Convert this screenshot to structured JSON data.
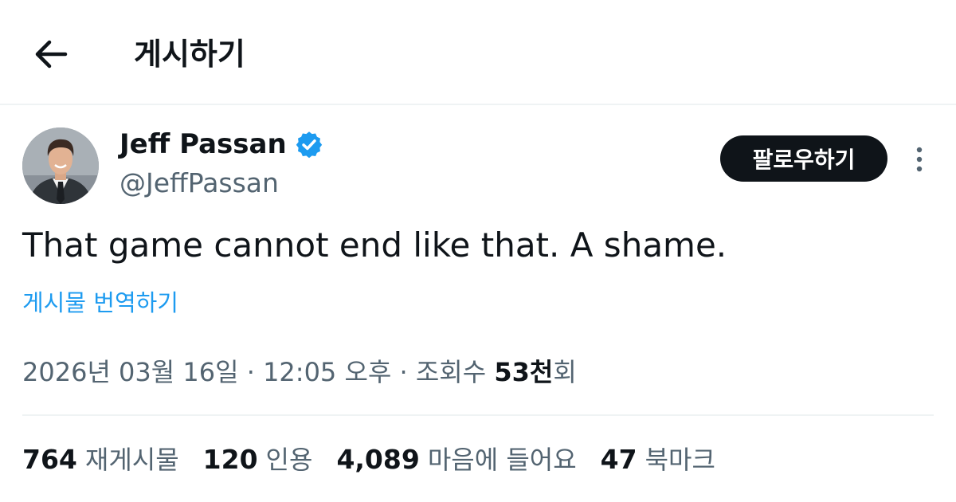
{
  "header": {
    "title": "게시하기",
    "back_icon": "arrow-left-icon"
  },
  "author": {
    "name": "Jeff Passan",
    "handle": "@JeffPassan",
    "verified": true,
    "verified_color": "#1d9bf0"
  },
  "follow_button": {
    "label": "팔로우하기"
  },
  "tweet": {
    "text": "That game cannot end like that. A shame.",
    "translate_label": "게시물 번역하기",
    "date": "2026년 03월 16일",
    "time": "12:05 오후",
    "views_label": "조회수",
    "views_count": "53천",
    "views_suffix": "회"
  },
  "stats": [
    {
      "value": "764",
      "label": "재게시물"
    },
    {
      "value": "120",
      "label": "인용"
    },
    {
      "value": "4,089",
      "label": "마음에 들어요"
    },
    {
      "value": "47",
      "label": "북마크"
    }
  ],
  "colors": {
    "accent": "#1d9bf0",
    "text_primary": "#0f1419",
    "text_secondary": "#536471",
    "divider": "#eff3f4"
  }
}
